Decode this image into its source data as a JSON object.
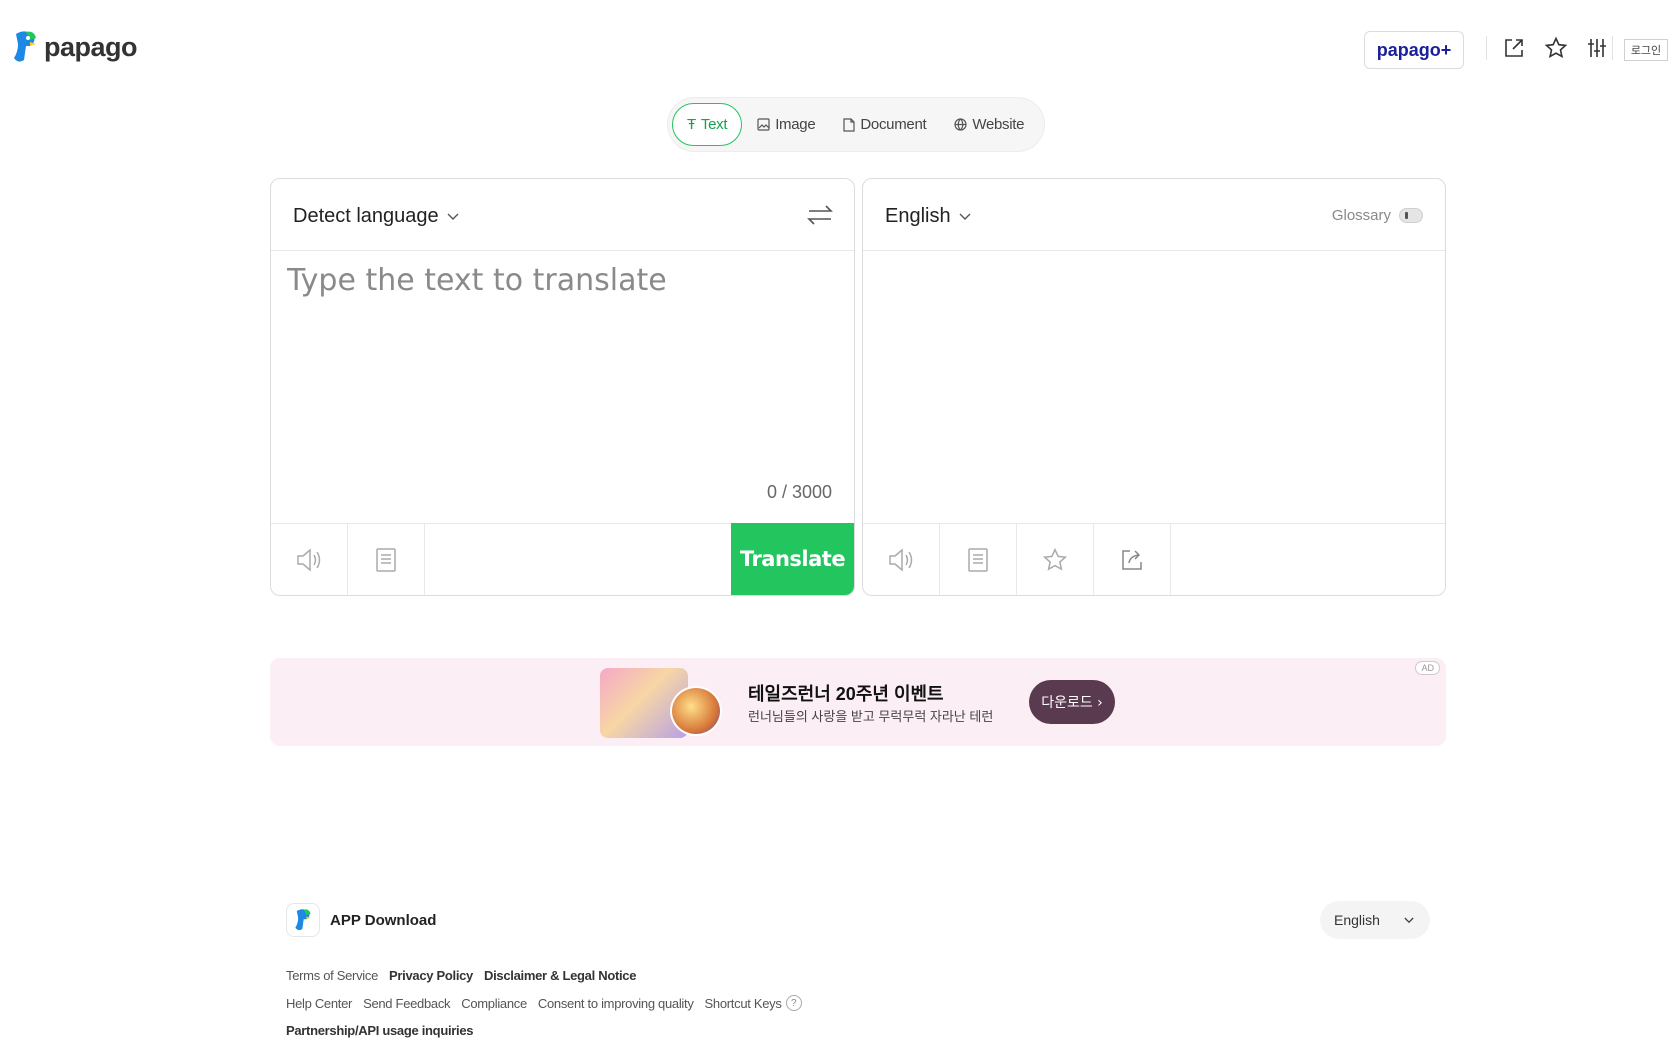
{
  "header": {
    "logo_text": "papago",
    "plus_label": "papago+",
    "login_label": "로그인",
    "icons": [
      "new-window-icon",
      "star-icon",
      "sliders-icon"
    ]
  },
  "tabs": [
    {
      "label": "Text",
      "icon": "text-icon",
      "active": true
    },
    {
      "label": "Image",
      "icon": "image-icon",
      "active": false
    },
    {
      "label": "Document",
      "icon": "document-icon",
      "active": false
    },
    {
      "label": "Website",
      "icon": "globe-icon",
      "active": false
    }
  ],
  "source": {
    "language": "Detect language",
    "placeholder": "Type the text to translate",
    "value": "",
    "char_count": "0 / 3000",
    "translate_label": "Translate"
  },
  "target": {
    "language": "English",
    "glossary_label": "Glossary"
  },
  "ad": {
    "title": "테일즈런너 20주년 이벤트",
    "subtitle": "런너님들의 사랑을 받고 무럭무럭 자라난 테런",
    "button_label": "다운로드 ›",
    "badge": "AD"
  },
  "footer": {
    "app_download": "APP Download",
    "language": "English",
    "links_row1": [
      "Terms of Service",
      "Privacy Policy",
      "Disclaimer & Legal Notice"
    ],
    "links_row2": [
      "Help Center",
      "Send Feedback",
      "Compliance",
      "Consent to improving quality",
      "Shortcut Keys"
    ],
    "links_row3": [
      "Partnership/API usage inquiries"
    ]
  },
  "colors": {
    "accent": "#22c55e",
    "brand_blue": "#1a1f9c"
  }
}
